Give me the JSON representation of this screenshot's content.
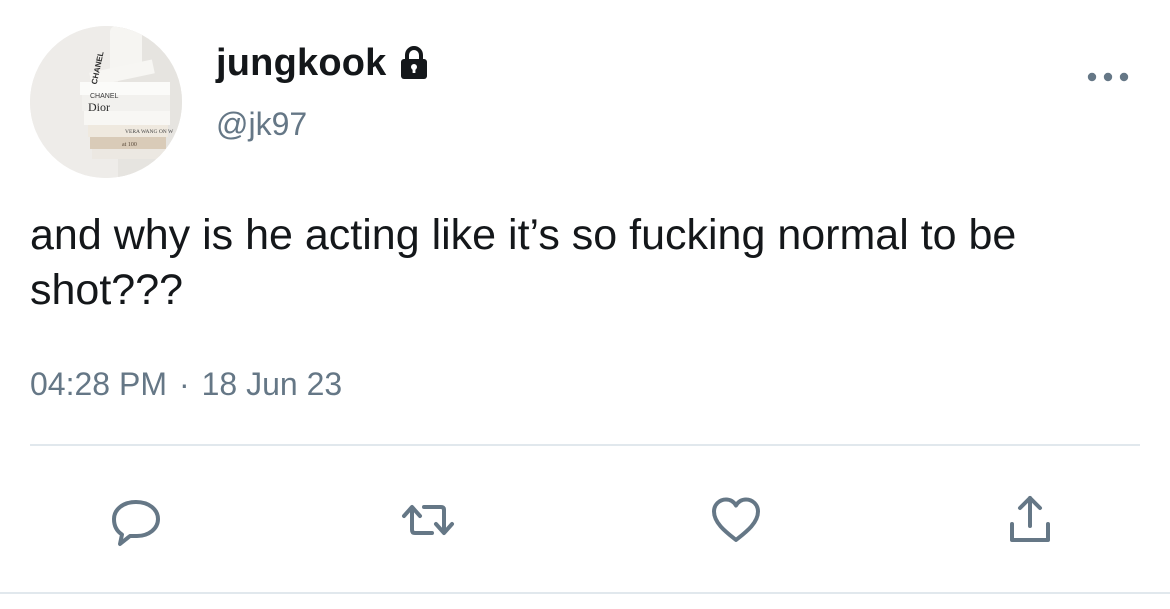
{
  "author": {
    "display_name": "jungkook",
    "handle": "@jk97",
    "protected_icon": "lock-icon",
    "avatar_book_spines": {
      "top": "CHANEL",
      "brand_1": "CHANEL",
      "brand_2": "Dior",
      "brand_3": "VERA WANG ON W",
      "brand_4": "at 100"
    }
  },
  "tweet": {
    "text": "and why is he acting like it’s so fucking normal to be shot???",
    "time": "04:28 PM",
    "separator": "·",
    "date": "18 Jun 23"
  },
  "actions": {
    "reply_icon": "reply-icon",
    "retweet_icon": "retweet-icon",
    "like_icon": "heart-icon",
    "share_icon": "share-icon",
    "more_icon": "more-dots-icon"
  },
  "colors": {
    "text_primary": "#14171a",
    "text_secondary": "#657786",
    "icon": "#657786",
    "divider": "#e1e8ed"
  }
}
